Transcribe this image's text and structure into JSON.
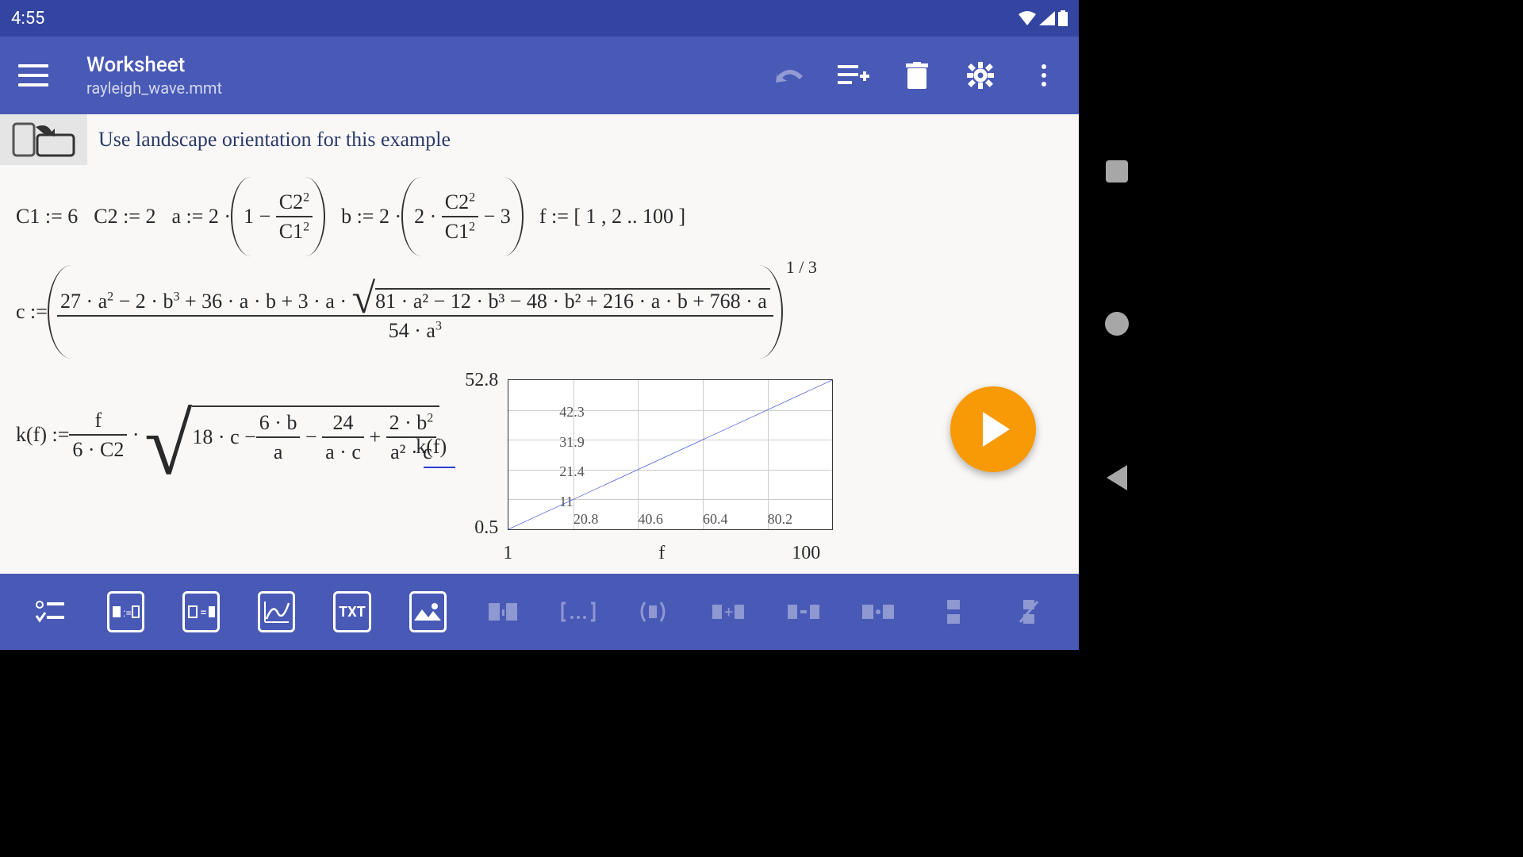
{
  "status": {
    "time": "4:55"
  },
  "header": {
    "title": "Worksheet",
    "subtitle": "rayleigh_wave.mmt"
  },
  "hint": "Use landscape orientation for this example",
  "defs": {
    "C1": "C1 := 6",
    "C2": "C2 := 2",
    "a_lhs": "a := 2 ·",
    "a_inner_1": "1 −",
    "frac_c2sq_num": "C2",
    "frac_c2sq_den": "C1",
    "b_lhs": "b := 2 ·",
    "b_inner_1": "2 ·",
    "b_inner_2": "− 3",
    "f_def": "f := [ 1 , 2 .. 100 ]",
    "c_lhs": "c :=",
    "c_num_pre": "27 · a",
    "c_num_mid": " − 2 · b",
    "c_num_mid2": " + 36 · a · b + 3 · a · ",
    "c_num_sqrt": "81 · a² − 12 · b³ − 48 · b² + 216 · a · b + 768 · a",
    "c_den": "54 · a",
    "c_exp": "1 / 3",
    "kf_lhs": "k(f) := ",
    "kf_frac1_num": "f",
    "kf_frac1_den": "6 · C2",
    "kf_sqrt_1": "18 · c − ",
    "kf_t1_num": "6 · b",
    "kf_t1_den": "a",
    "kf_t2_num": "24",
    "kf_t2_den": "a · c",
    "kf_t3_num": "2 · b",
    "kf_t3_den": "a² · c",
    "plot_label": "k(f)"
  },
  "chart_data": {
    "type": "line",
    "xlabel": "f",
    "ylabel": "",
    "xlim": [
      1.0,
      100.0
    ],
    "ylim": [
      0.5,
      52.8
    ],
    "x_ticks": [
      20.8,
      40.6,
      60.4,
      80.2
    ],
    "y_ticks": [
      11.0,
      21.4,
      31.9,
      42.3
    ],
    "x": [
      1.0,
      100.0
    ],
    "y": [
      0.5,
      52.8
    ],
    "series_name": "k(f)",
    "color": "#2a3fd4"
  },
  "bottom_tools": {
    "txt": "TXT"
  }
}
